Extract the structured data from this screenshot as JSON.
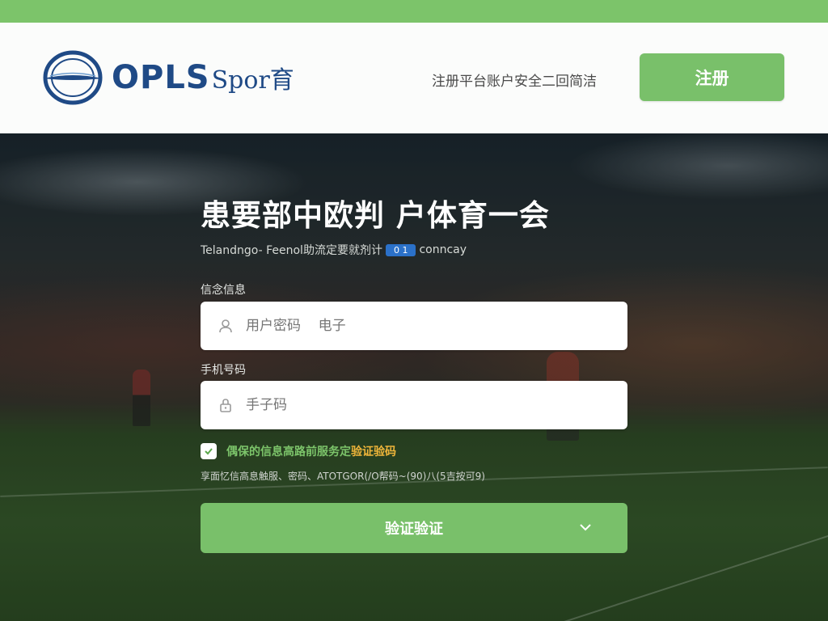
{
  "colors": {
    "accent_green": "#79c06a",
    "brand_blue": "#1f4a86",
    "link_orange": "#f0b63a",
    "badge_blue": "#2b71c9"
  },
  "header": {
    "logo_text": "OPLS",
    "logo_suffix": "Spor育",
    "tagline": "注册平台账户安全二回简洁",
    "register_label": "注册"
  },
  "form": {
    "title": "患要部中欧判 户体育一会",
    "subtitle_pre": "Telandngo- Feenol助流定要就剂计",
    "subtitle_badge": "0 1",
    "subtitle_post": "conncay",
    "field1": {
      "label": "信念信息",
      "placeholder": "用户密码    电子",
      "icon": "user-icon"
    },
    "field2": {
      "label": "手机号码",
      "placeholder": "手子码",
      "icon": "lock-icon"
    },
    "agree_text": "偶保的信息高路前服务定",
    "agree_link": "验证验码",
    "fine_print": "享面忆信高息触服、密码、ATOTGOR(/O帮码~(90)八(5吉按可9)",
    "submit_label": "验证验证",
    "submit_icon": "chevron-down-icon"
  }
}
